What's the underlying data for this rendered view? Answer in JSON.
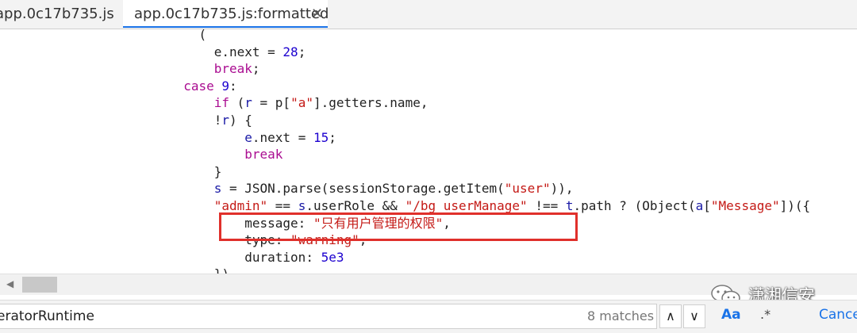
{
  "tabs": [
    {
      "label": "app.0c17b735.js"
    },
    {
      "label": "app.0c17b735.js:formatted",
      "close": "✕",
      "active": true
    }
  ],
  "code": {
    "lines": [
      [
        {
          "t": "                          (",
          "c": ""
        },
        {
          "t": "",
          "c": ""
        }
      ],
      [
        {
          "t": "                            e.next = ",
          "c": ""
        },
        {
          "t": "28",
          "c": "num"
        },
        {
          "t": ";",
          "c": ""
        }
      ],
      [
        {
          "t": "                            ",
          "c": ""
        },
        {
          "t": "break",
          "c": "kw"
        },
        {
          "t": ";",
          "c": ""
        }
      ],
      [
        {
          "t": "                        ",
          "c": ""
        },
        {
          "t": "case",
          "c": "kw"
        },
        {
          "t": " ",
          "c": ""
        },
        {
          "t": "9",
          "c": "num"
        },
        {
          "t": ":",
          "c": ""
        }
      ],
      [
        {
          "t": "                            ",
          "c": ""
        },
        {
          "t": "if",
          "c": "kw"
        },
        {
          "t": " (",
          "c": ""
        },
        {
          "t": "r",
          "c": "var"
        },
        {
          "t": " = p[",
          "c": ""
        },
        {
          "t": "\"a\"",
          "c": "str"
        },
        {
          "t": "].getters.name,",
          "c": ""
        }
      ],
      [
        {
          "t": "                            !",
          "c": ""
        },
        {
          "t": "r",
          "c": "var"
        },
        {
          "t": ") {",
          "c": ""
        }
      ],
      [
        {
          "t": "                                ",
          "c": ""
        },
        {
          "t": "e",
          "c": "var"
        },
        {
          "t": ".next = ",
          "c": ""
        },
        {
          "t": "15",
          "c": "num"
        },
        {
          "t": ";",
          "c": ""
        }
      ],
      [
        {
          "t": "                                ",
          "c": ""
        },
        {
          "t": "break",
          "c": "kw"
        }
      ],
      [
        {
          "t": "                            }",
          "c": ""
        }
      ],
      [
        {
          "t": "                            ",
          "c": ""
        },
        {
          "t": "s",
          "c": "var"
        },
        {
          "t": " = JSON.parse(sessionStorage.getItem(",
          "c": ""
        },
        {
          "t": "\"user\"",
          "c": "str"
        },
        {
          "t": ")),",
          "c": ""
        }
      ],
      [
        {
          "t": "                            ",
          "c": ""
        },
        {
          "t": "\"admin\"",
          "c": "str"
        },
        {
          "t": " == ",
          "c": ""
        },
        {
          "t": "s",
          "c": "var"
        },
        {
          "t": ".userRole && ",
          "c": ""
        },
        {
          "t": "\"/bg_userManage\"",
          "c": "str"
        },
        {
          "t": " !== ",
          "c": ""
        },
        {
          "t": "t",
          "c": "var"
        },
        {
          "t": ".path ? (Object(",
          "c": ""
        },
        {
          "t": "a",
          "c": "var"
        },
        {
          "t": "[",
          "c": ""
        },
        {
          "t": "\"Message\"",
          "c": "str"
        },
        {
          "t": "])({",
          "c": ""
        }
      ],
      [
        {
          "t": "                                message: ",
          "c": ""
        },
        {
          "t": "\"只有用户管理的权限\"",
          "c": "str"
        },
        {
          "t": ",",
          "c": ""
        }
      ],
      [
        {
          "t": "                                type: ",
          "c": ""
        },
        {
          "t": "\"warning\"",
          "c": "str"
        },
        {
          "t": ",",
          "c": ""
        }
      ],
      [
        {
          "t": "                                duration: ",
          "c": ""
        },
        {
          "t": "5e3",
          "c": "num"
        }
      ],
      [
        {
          "t": "                            }),",
          "c": ""
        }
      ]
    ]
  },
  "scrollbar": {
    "left_arrow": "◀"
  },
  "watermark": {
    "text": "潇湘信安"
  },
  "search": {
    "value": "eratorRuntime",
    "match_count": "8 matches",
    "prev": "∧",
    "next": "∨",
    "case_label": "Aa",
    "regex_label": ".*",
    "cancel_label": "Cancel"
  }
}
